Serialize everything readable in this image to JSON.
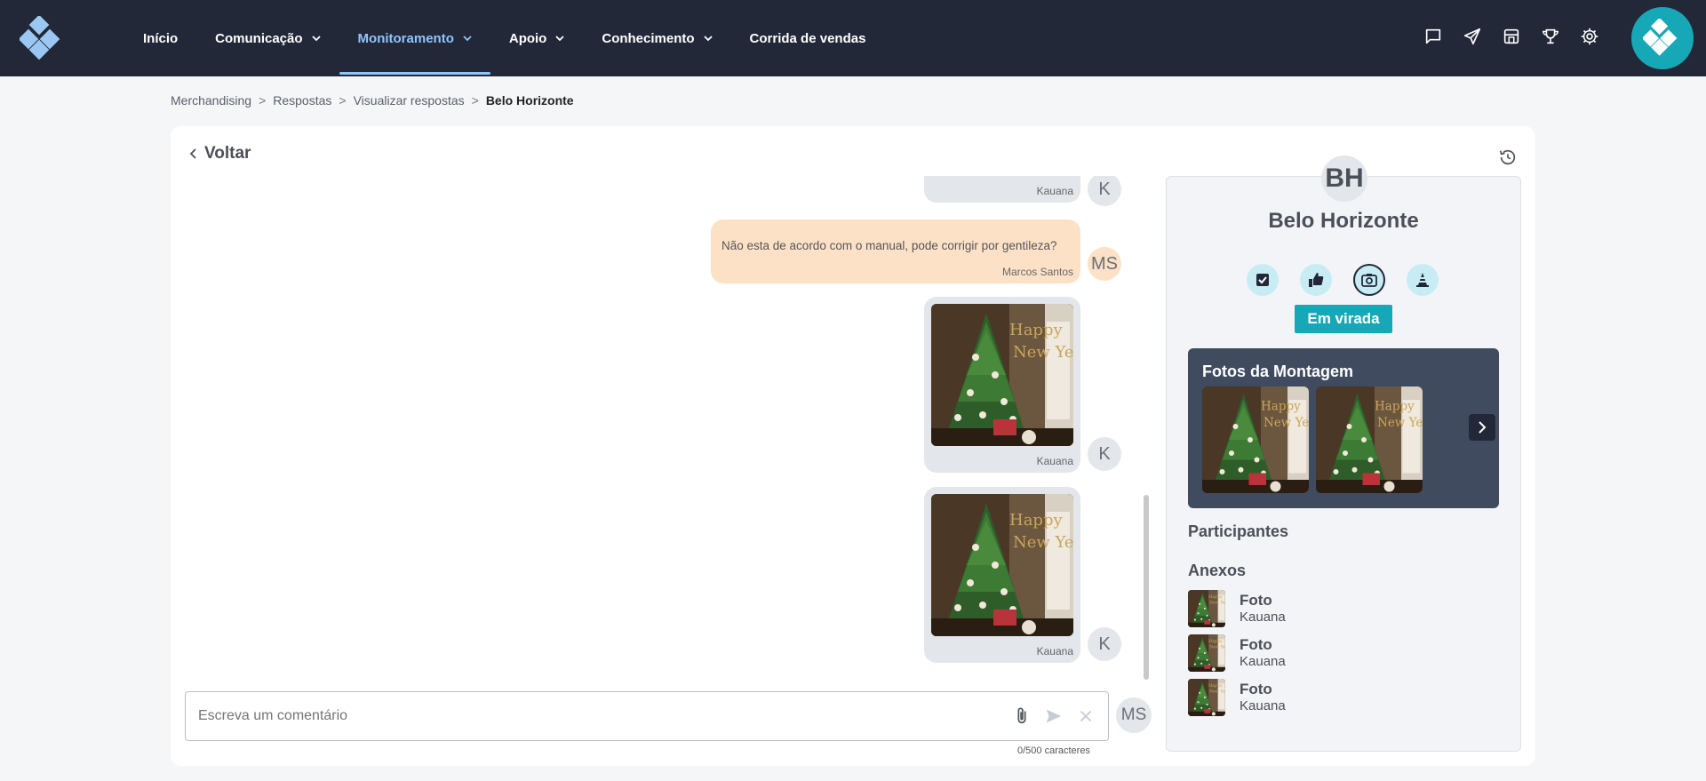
{
  "nav": {
    "items": [
      {
        "label": "Início",
        "dropdown": false
      },
      {
        "label": "Comunicação",
        "dropdown": true
      },
      {
        "label": "Monitoramento",
        "dropdown": true,
        "active": true
      },
      {
        "label": "Apoio",
        "dropdown": true
      },
      {
        "label": "Conhecimento",
        "dropdown": true
      },
      {
        "label": "Corrida de vendas",
        "dropdown": false
      }
    ],
    "icons": [
      "chat-icon",
      "send-icon",
      "store-icon",
      "trophy-icon",
      "gear-icon"
    ]
  },
  "breadcrumb": {
    "items": [
      "Merchandising",
      "Respostas",
      "Visualizar respostas"
    ],
    "current": "Belo Horizonte",
    "separator": ">"
  },
  "back_label": "Voltar",
  "chat": {
    "messages": [
      {
        "type": "text",
        "author": "Kauana",
        "avatar": "K"
      },
      {
        "type": "text",
        "text": "Não esta de acordo com o manual, pode corrigir por gentileza?",
        "author": "Marcos Santos",
        "avatar": "MS"
      },
      {
        "type": "photo",
        "author": "Kauana",
        "avatar": "K"
      },
      {
        "type": "photo",
        "author": "Kauana",
        "avatar": "K"
      }
    ],
    "composer": {
      "placeholder": "Escreva um comentário",
      "counter": "0/500 caracteres",
      "avatar": "MS"
    }
  },
  "panel": {
    "avatar": "BH",
    "title": "Belo Horizonte",
    "status_icons": [
      "checkbox-icon",
      "thumbs-up-icon",
      "camera-icon",
      "cone-icon"
    ],
    "selected_status_icon": "camera-icon",
    "status_badge": "Em virada",
    "fotos_title": "Fotos da Montagem",
    "participants_label": "Participantes",
    "attachments_label": "Anexos",
    "attachments": [
      {
        "title": "Foto",
        "author": "Kauana"
      },
      {
        "title": "Foto",
        "author": "Kauana"
      },
      {
        "title": "Foto",
        "author": "Kauana"
      }
    ]
  },
  "colors": {
    "topbar": "#232838",
    "accent": "#17a8b8",
    "nav_active": "#8ec5ff",
    "user_bubble": "#fde1c7",
    "other_bubble": "#e3e6ea"
  }
}
